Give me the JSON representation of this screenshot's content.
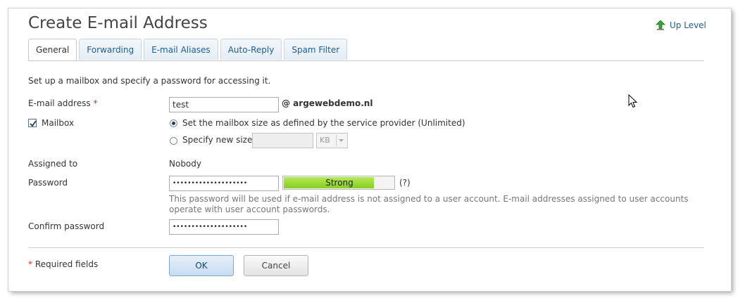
{
  "page": {
    "title": "Create E-mail Address",
    "up_level": "Up Level"
  },
  "tabs": [
    {
      "label": "General",
      "active": true
    },
    {
      "label": "Forwarding",
      "active": false
    },
    {
      "label": "E-mail Aliases",
      "active": false
    },
    {
      "label": "Auto-Reply",
      "active": false
    },
    {
      "label": "Spam Filter",
      "active": false
    }
  ],
  "form": {
    "intro": "Set up a mailbox and specify a password for accessing it.",
    "email_label": "E-mail address",
    "required_mark": "*",
    "email_value": "test",
    "domain": "@ argewebdemo.nl",
    "mailbox_label": "Mailbox",
    "mailbox_checked": true,
    "size_option_default": "Set the mailbox size as defined by the service provider (Unlimited)",
    "size_option_custom": "Specify new size",
    "size_value": "",
    "size_unit": "KB",
    "assigned_label": "Assigned to",
    "assigned_value": "Nobody",
    "password_label": "Password",
    "password_mask": "••••••••••••••••••••",
    "strength_label": "Strong",
    "strength_level": 0.82,
    "strength_help": "(?)",
    "password_hint": "This password will be used if e-mail address is not assigned to a user account. E-mail addresses assigned to user accounts operate with user account passwords.",
    "confirm_label": "Confirm password",
    "confirm_mask": "••••••••••••••••••••",
    "required_note": "Required fields",
    "ok_label": "OK",
    "cancel_label": "Cancel"
  },
  "colors": {
    "link": "#1a5d9c",
    "required": "#dd2222",
    "strength_fill": "#86cc23"
  }
}
